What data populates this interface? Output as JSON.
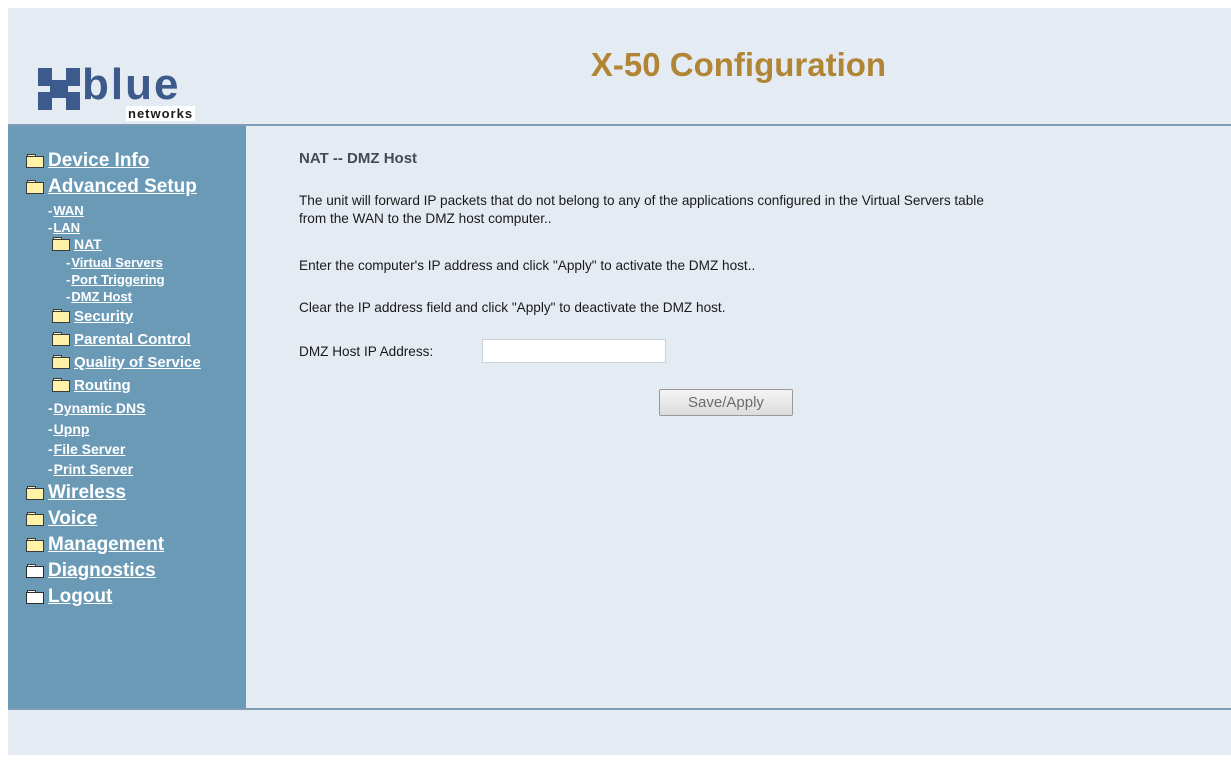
{
  "header": {
    "title": "X-50 Configuration",
    "logo_word": "blue",
    "logo_sub": "networks"
  },
  "nav": {
    "device_info": "Device Info",
    "advanced_setup": "Advanced Setup",
    "wan": "WAN",
    "lan": "LAN",
    "nat": "NAT",
    "virtual_servers": "Virtual Servers",
    "port_triggering": "Port Triggering",
    "dmz_host": "DMZ Host",
    "security": "Security",
    "parental_control": "Parental Control",
    "quality_of_service": "Quality of Service",
    "routing": "Routing",
    "dynamic_dns": "Dynamic DNS",
    "upnp": "Upnp",
    "file_server": "File Server",
    "print_server": "Print Server",
    "wireless": "Wireless",
    "voice": "Voice",
    "management": "Management",
    "diagnostics": "Diagnostics",
    "logout": "Logout"
  },
  "content": {
    "heading": "NAT -- DMZ Host",
    "para1_line1": "The unit will forward IP packets that do not belong to any of the applications configured in the Virtual Servers table",
    "para1_line2": "from the WAN to the DMZ host computer..",
    "para2": "Enter the computer's IP address and click \"Apply\" to activate the DMZ host..",
    "para3": "Clear the IP address field and click \"Apply\" to deactivate the DMZ host.",
    "dmz_label": "DMZ Host IP Address:",
    "dmz_value": "",
    "save_label": "Save/Apply"
  },
  "colors": {
    "sidebar": "#6b9ab7",
    "background": "#e5ebf3",
    "title": "#b08534",
    "logo": "#3d5a8c"
  }
}
